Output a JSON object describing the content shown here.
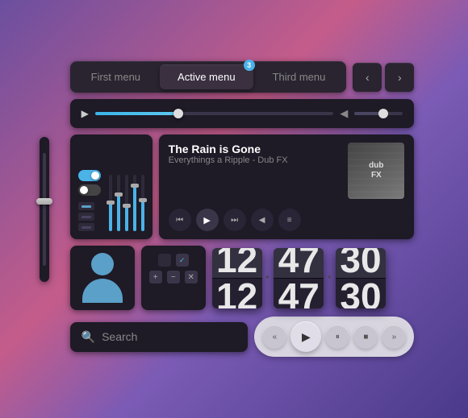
{
  "menu": {
    "tabs": [
      {
        "id": "first",
        "label": "First menu",
        "active": false
      },
      {
        "id": "active",
        "label": "Active menu",
        "active": true,
        "badge": "3"
      },
      {
        "id": "third",
        "label": "Third menu",
        "active": false
      }
    ]
  },
  "nav": {
    "prev_label": "‹",
    "next_label": "›"
  },
  "player": {
    "progress": "35",
    "volume": "60"
  },
  "music": {
    "title": "The Rain is Gone",
    "artist": "Everythings a Ripple - Dub FX",
    "album_label": "dub\nFX"
  },
  "clock": {
    "hours": "12",
    "minutes": "47",
    "seconds": "30"
  },
  "search": {
    "placeholder": "Search",
    "icon": "🔍"
  },
  "media_controls": {
    "rewind": "«",
    "play": "▶",
    "pause": "⏸",
    "stop": "■",
    "forward": "»"
  }
}
